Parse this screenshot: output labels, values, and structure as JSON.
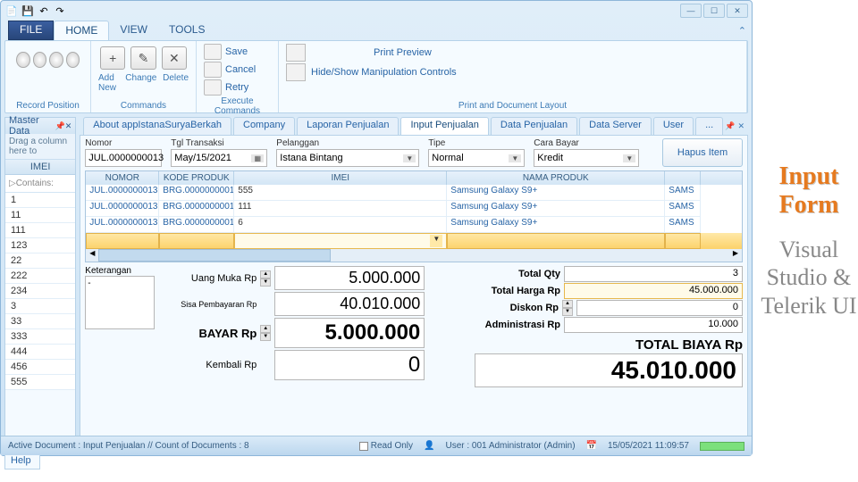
{
  "ribbon": {
    "file": "FILE",
    "tabs": [
      "HOME",
      "VIEW",
      "TOOLS"
    ],
    "groups": {
      "record": "Record Position",
      "commands": "Commands",
      "commands_btns": [
        "Add New",
        "Change",
        "Delete"
      ],
      "exec": "Execute Commands",
      "exec_items": [
        "Save",
        "Cancel",
        "Retry"
      ],
      "print": "Print and Document Layout",
      "print_items": [
        "Print Preview",
        "Hide/Show Manipulation Controls"
      ]
    }
  },
  "sidebar": {
    "title": "Master Data",
    "hint": "Drag a column here to",
    "col": "IMEI",
    "filter": "Contains:",
    "items": [
      "1",
      "11",
      "111",
      "123",
      "22",
      "222",
      "234",
      "3",
      "33",
      "333",
      "444",
      "456",
      "555"
    ]
  },
  "doctabs": [
    "About appIstanaSuryaBerkah",
    "Company",
    "Laporan Penjualan",
    "Input Penjualan",
    "Data Penjualan",
    "Data Server",
    "User",
    "..."
  ],
  "form": {
    "nomor_lbl": "Nomor",
    "nomor": "JUL.0000000013",
    "tgl_lbl": "Tgl Transaksi",
    "tgl": "May/15/2021",
    "pel_lbl": "Pelanggan",
    "pel": "Istana Bintang",
    "tipe_lbl": "Tipe",
    "tipe": "Normal",
    "cara_lbl": "Cara Bayar",
    "cara": "Kredit",
    "hapus": "Hapus Item"
  },
  "grid": {
    "cols": [
      "NOMOR",
      "KODE PRODUK",
      "IMEI",
      "NAMA PRODUK",
      ""
    ],
    "rows": [
      {
        "nomor": "JUL.0000000013...",
        "kode": "BRG.0000000001",
        "imei": "555",
        "nama": "Samsung Galaxy S9+",
        "rest": "SAMS"
      },
      {
        "nomor": "JUL.0000000013...",
        "kode": "BRG.0000000001",
        "imei": "111",
        "nama": "Samsung Galaxy S9+",
        "rest": "SAMS"
      },
      {
        "nomor": "JUL.0000000013...",
        "kode": "BRG.0000000001",
        "imei": "6",
        "nama": "Samsung Galaxy S9+",
        "rest": "SAMS"
      }
    ]
  },
  "bottom": {
    "ket_lbl": "Keterangan",
    "ket": "-",
    "uang_lbl": "Uang Muka Rp",
    "uang": "5.000.000",
    "sisa_lbl": "Sisa Pembayaran Rp",
    "sisa": "40.010.000",
    "bayar_lbl": "BAYAR Rp",
    "bayar": "5.000.000",
    "kembali_lbl": "Kembali Rp",
    "kembali": "0",
    "tqty_lbl": "Total Qty",
    "tqty": "3",
    "tharga_lbl": "Total Harga Rp",
    "tharga": "45.000.000",
    "diskon_lbl": "Diskon Rp",
    "diskon": "0",
    "admin_lbl": "Administrasi Rp",
    "admin": "10.000",
    "total_lbl": "TOTAL BIAYA Rp",
    "total": "45.010.000"
  },
  "help": "Help",
  "status": {
    "doc": "Active Document : Input Penjualan // Count of Documents : 8",
    "ro": "Read Only",
    "user": "User : 001 Administrator (Admin)",
    "time": "15/05/2021 11:09:57"
  },
  "decor": {
    "t1": "Input Form",
    "t2": "Visual Studio & Telerik UI"
  }
}
